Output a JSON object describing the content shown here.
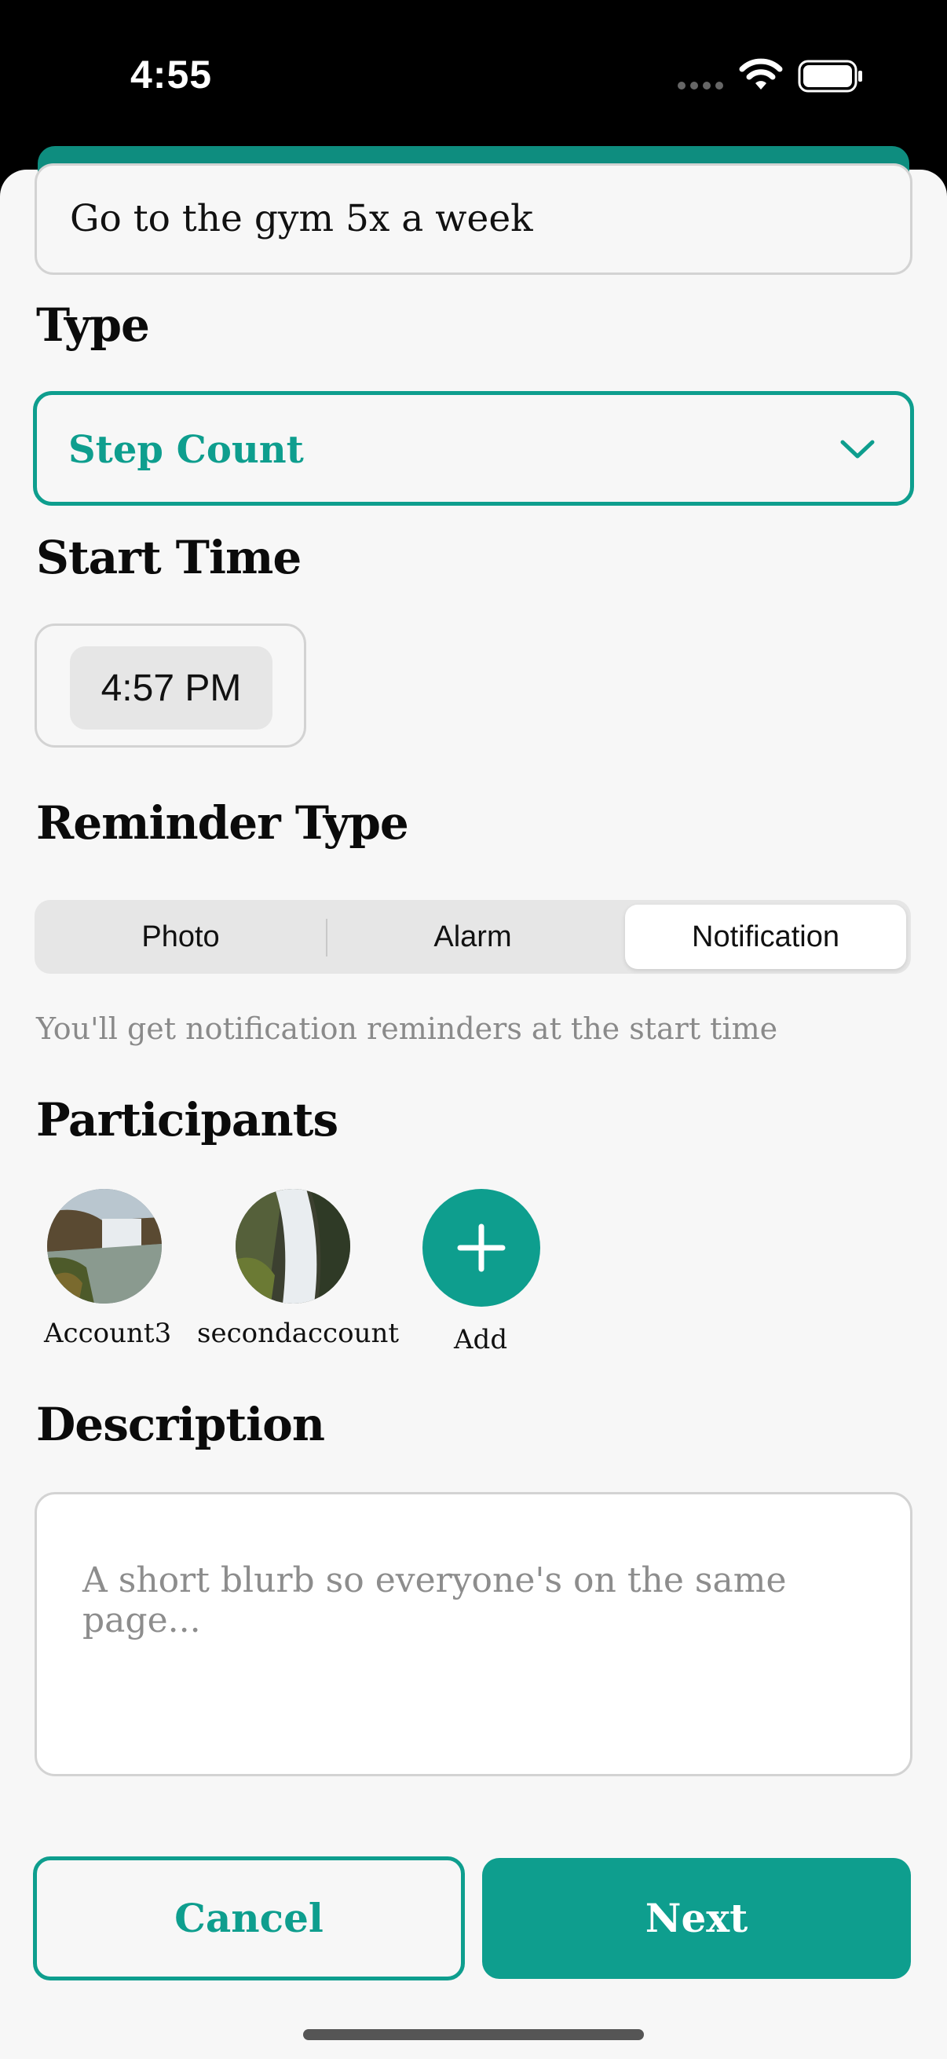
{
  "status": {
    "time": "4:55"
  },
  "goal_title": "Go to the gym 5x a week",
  "type_section": {
    "title": "Type",
    "selected": "Step Count"
  },
  "start_time": {
    "title": "Start Time",
    "value": "4:57 PM"
  },
  "reminder": {
    "title": "Reminder Type",
    "options": [
      "Photo",
      "Alarm",
      "Notification"
    ],
    "selected": "Notification",
    "hint": "You'll get notification reminders at the start time"
  },
  "participants": {
    "title": "Participants",
    "people": [
      {
        "name": "Account3"
      },
      {
        "name": "secondaccount"
      }
    ],
    "add_label": "Add"
  },
  "description": {
    "title": "Description",
    "placeholder": "A short blurb so everyone's on the same page..."
  },
  "buttons": {
    "cancel": "Cancel",
    "next": "Next"
  },
  "colors": {
    "accent": "#0e9e8e",
    "strip": "#0e8d7f"
  }
}
